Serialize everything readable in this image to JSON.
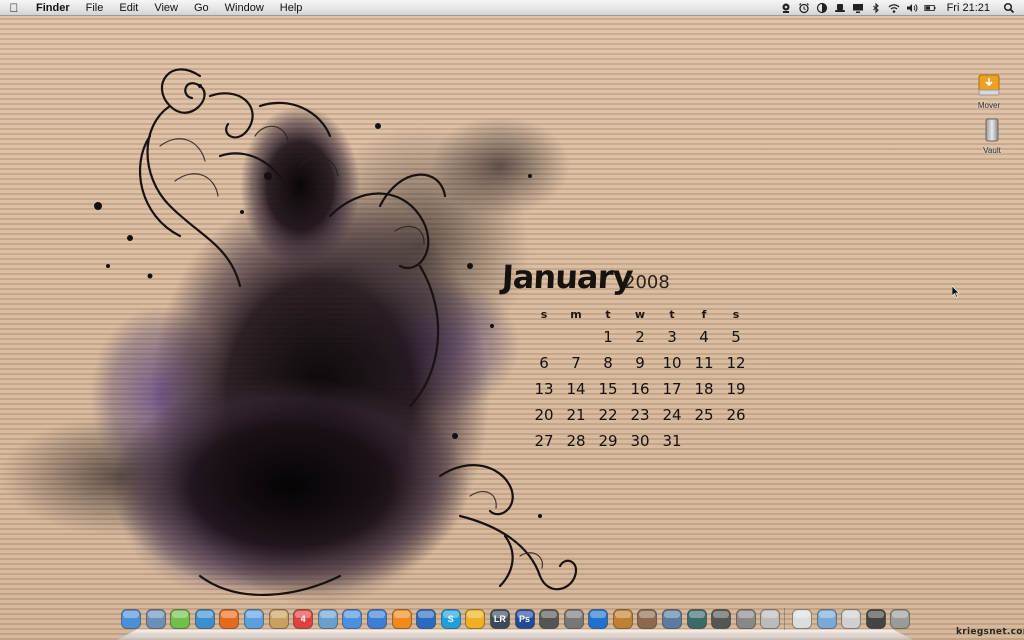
{
  "menubar": {
    "apple_icon": "apple-logo-icon",
    "items": [
      "Finder",
      "File",
      "Edit",
      "View",
      "Go",
      "Window",
      "Help"
    ],
    "status_icons": [
      "webcam-icon",
      "alarm-clock-icon",
      "half-moon-icon",
      "hat-icon",
      "display-icon",
      "bluetooth-icon",
      "wifi-icon",
      "volume-icon",
      "battery-icon"
    ],
    "clock": "Fri 21:21",
    "spotlight_icon": "spotlight-search-icon"
  },
  "calendar": {
    "month": "January",
    "year": "2008",
    "weekdays": [
      "s",
      "m",
      "t",
      "w",
      "t",
      "f",
      "s"
    ],
    "weeks": [
      [
        "",
        "",
        "1",
        "2",
        "3",
        "4",
        "5"
      ],
      [
        "6",
        "7",
        "8",
        "9",
        "10",
        "11",
        "12"
      ],
      [
        "13",
        "14",
        "15",
        "16",
        "17",
        "18",
        "19"
      ],
      [
        "20",
        "21",
        "22",
        "23",
        "24",
        "25",
        "26"
      ],
      [
        "27",
        "28",
        "29",
        "30",
        "31",
        "",
        ""
      ]
    ]
  },
  "desktop_icons": [
    {
      "label": "Mover",
      "icon": "external-drive-icon"
    },
    {
      "label": "Vault",
      "icon": "hard-drive-icon"
    }
  ],
  "dock": {
    "items": [
      {
        "name": "finder",
        "icon": "finder-icon",
        "color": "#4a8fd8"
      },
      {
        "name": "mail",
        "icon": "mail-icon",
        "color": "#6a8fb8"
      },
      {
        "name": "ichat",
        "icon": "chat-buddy-icon",
        "color": "#6fbf4a"
      },
      {
        "name": "safari",
        "icon": "compass-icon",
        "color": "#3b8fd0"
      },
      {
        "name": "firefox",
        "icon": "firefox-icon",
        "color": "#e66a1e"
      },
      {
        "name": "video-chat",
        "icon": "video-chat-icon",
        "color": "#5aa0e0"
      },
      {
        "name": "address-book",
        "icon": "address-book-icon",
        "color": "#c9a060"
      },
      {
        "name": "ical",
        "icon": "calendar-icon",
        "color": "#e04040",
        "text": "4"
      },
      {
        "name": "iphoto",
        "icon": "photo-icon",
        "color": "#6aa0d0"
      },
      {
        "name": "itunes",
        "icon": "music-note-icon",
        "color": "#4a90e0"
      },
      {
        "name": "quicktime",
        "icon": "quicktime-icon",
        "color": "#3a7ed6"
      },
      {
        "name": "vlc",
        "icon": "traffic-cone-icon",
        "color": "#f08a1a"
      },
      {
        "name": "bird",
        "icon": "bird-icon",
        "color": "#2a6ac0"
      },
      {
        "name": "skype",
        "icon": "skype-icon",
        "color": "#1ea0e0",
        "text": "S"
      },
      {
        "name": "transmit",
        "icon": "warning-sign-icon",
        "color": "#f0b020"
      },
      {
        "name": "lightroom",
        "icon": "lightroom-icon",
        "color": "#3a4a5a",
        "text": "LR"
      },
      {
        "name": "photoshop",
        "icon": "photoshop-icon",
        "color": "#1f4a9a",
        "text": "Ps"
      },
      {
        "name": "aperture",
        "icon": "camera-icon",
        "color": "#555555"
      },
      {
        "name": "imovie",
        "icon": "star-icon",
        "color": "#777777"
      },
      {
        "name": "dvd-player",
        "icon": "disc-icon",
        "color": "#2070d0"
      },
      {
        "name": "garageband",
        "icon": "guitar-icon",
        "color": "#c08030"
      },
      {
        "name": "preview",
        "icon": "picture-icon",
        "color": "#8a6a4a"
      },
      {
        "name": "spaces",
        "icon": "grid-icon",
        "color": "#5a7aa0"
      },
      {
        "name": "time-machine",
        "icon": "clock-icon",
        "color": "#3a6a6a"
      },
      {
        "name": "system-prefs",
        "icon": "gauge-icon",
        "color": "#555555"
      },
      {
        "name": "utilities",
        "icon": "terminal-icon",
        "color": "#888888"
      },
      {
        "name": "stack-1",
        "icon": "document-stack-icon",
        "color": "#bbbbbb"
      },
      {
        "name": "stack-2",
        "icon": "document-icon",
        "color": "#dddddd"
      },
      {
        "name": "applications",
        "icon": "folder-icon",
        "color": "#7aa8d8"
      },
      {
        "name": "downloads",
        "icon": "folder-docs-icon",
        "color": "#cfcfcf"
      },
      {
        "name": "pictures",
        "icon": "cat-picture-icon",
        "color": "#444444"
      },
      {
        "name": "trash",
        "icon": "trash-icon",
        "color": "#9a9a9a"
      }
    ]
  },
  "watermark": "kriegsnet.com"
}
